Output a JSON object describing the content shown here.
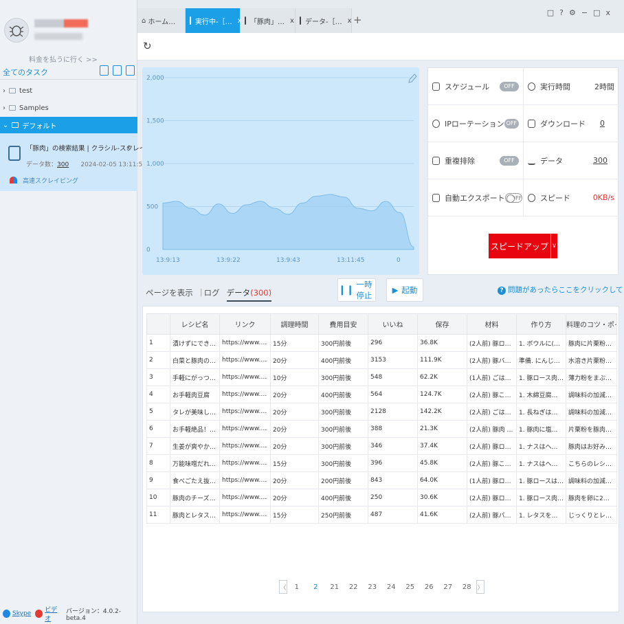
{
  "sidebar": {
    "upgrade_link": "料金を払うに行く >>",
    "all_tasks": "全てのタスク",
    "tree": [
      "test",
      "Samples",
      "デフォルト"
    ],
    "task": {
      "title": "「豚肉」の検索結果 | クラシル-スクレイピ…",
      "close": "x",
      "count_label": "データ数：",
      "count": "300",
      "date": "2024-02-05 13:11:50",
      "mode": "高速スクレイピング"
    },
    "footer": {
      "skype": "Skype",
      "video": "ビデオ",
      "version": "バージョン：4.0.2-beta.4"
    }
  },
  "tabs": [
    {
      "label": "ホーム…"
    },
    {
      "label": "実行中-［…"
    },
    {
      "label": "「豚肉」…"
    },
    {
      "label": "データ-［…"
    }
  ],
  "tab_close": "x",
  "tab_add": "+",
  "window_controls": [
    "□",
    "?",
    "⚙",
    "−",
    "□",
    "x"
  ],
  "chart_data": {
    "type": "area",
    "y_ticks": [
      "2,000",
      "1,500",
      "1,000",
      "500",
      "0"
    ],
    "x_ticks": [
      "13:9:13",
      "13:9:22",
      "13:9:43",
      "13:11:45",
      "0"
    ],
    "ylim": [
      0,
      2000
    ],
    "grid": true,
    "values": [
      540,
      560,
      480,
      400,
      530,
      420,
      520,
      560,
      480,
      410,
      540,
      620,
      640,
      610,
      480,
      450,
      560,
      430,
      30
    ]
  },
  "settings": {
    "rows": [
      {
        "left": {
          "label": "スケジュール",
          "toggle": "OFF"
        },
        "right": {
          "label": "実行時間",
          "value": "2時間"
        }
      },
      {
        "left": {
          "label": "IPローテーション",
          "toggle": "OFF"
        },
        "right": {
          "label": "ダウンロード",
          "value": "0"
        }
      },
      {
        "left": {
          "label": "重複排除",
          "toggle": "OFF"
        },
        "right": {
          "label": "データ",
          "value": "300"
        }
      },
      {
        "left": {
          "label": "自動エクスポート",
          "toggle": "OFF"
        },
        "right": {
          "label": "スピード",
          "value": "0KB/s"
        }
      }
    ],
    "speedup": "スピードアップ",
    "speedup_dropdown": "∨"
  },
  "subtabs": {
    "page": "ページを表示",
    "sep": "|",
    "log": "ログ",
    "data": "データ",
    "data_count": "(300)"
  },
  "buttons": {
    "pause": "一時停止",
    "start": "起動"
  },
  "help_icon": "?",
  "help": "問題があったらここをクリックしてください",
  "table": {
    "headers": [
      "",
      "レシピ名",
      "リンク",
      "調理時間",
      "費用目安",
      "いいね",
      "保存",
      "材料",
      "作り方",
      "料理のコツ・ポイン"
    ],
    "rows": [
      [
        "1",
        "漬けずにできる！豚…",
        "https://www.kurashir…",
        "15分",
        "300円前後",
        "296",
        "36.8K",
        "(2人前) 豚ロース肉…",
        "1. ボウルに(A)を入…",
        "豚肉に片栗粉をつけ…"
      ],
      [
        "2",
        "白菜と豚肉のうま煮",
        "https://www.kurashir…",
        "20分",
        "400円前後",
        "3153",
        "111.9K",
        "(2人前) 豚バラ肉(…",
        "準備. にんじんは皮…",
        "水溶き片栗粉は、片…"
      ],
      [
        "3",
        "手軽にがっつり！豚…",
        "https://www.kurashir…",
        "10分",
        "300円前後",
        "548",
        "62.2K",
        "(1人前) ごはん 300…",
        "1. 豚ロース肉に薄…",
        "薄力粉をまぶすと、…"
      ],
      [
        "4",
        "お手軽肉豆腐",
        "https://www.kurashir…",
        "20分",
        "400円前後",
        "564",
        "124.7K",
        "(2人前) 豚こま切れ…",
        "1. 木綿豆腐は8等分…",
        "調味料の加減は、お…"
      ],
      [
        "5",
        "タレが美味しいジュ…",
        "https://www.kurashir…",
        "20分",
        "300円前後",
        "2128",
        "142.2K",
        "(2人前) ごはん 300…",
        "1. 長ねぎは縦に切…",
        "調味料の加減は、お…"
      ],
      [
        "6",
        "お手軽絶品！豚ロー…",
        "https://www.kurashir…",
        "20分",
        "300円前後",
        "388",
        "21.3K",
        "(2人前) 豚肉 (ロー…",
        "1. 豚肉に塩こしょ…",
        "片栗粉を豚肉にまぶ…"
      ],
      [
        "7",
        "生姜が爽やかな豚肉…",
        "https://www.kurashir…",
        "20分",
        "300円前後",
        "346",
        "37.4K",
        "(2人前) 豚ロース (…",
        "1. ナスはヘタを切…",
        "豚肉はお好みの部位…"
      ],
      [
        "8",
        "万能味噌だれで作る…",
        "https://www.kurashir…",
        "15分",
        "300円前後",
        "396",
        "45.8K",
        "(2人前) 豚こま切れ…",
        "1. ナスはヘタを切…",
        "こちらのレシピは、…"
      ],
      [
        "9",
        "食べごたえ抜群！ト…",
        "https://www.kurashir…",
        "20分",
        "200円前後",
        "843",
        "64.0K",
        "(1人前) 豚ロース (…",
        "1. 豚ロースは5ヶ所…",
        "調味料の加減は、お…"
      ],
      [
        "10",
        "豚肉のチーズ入りピ…",
        "https://www.kurashir…",
        "20分",
        "400円前後",
        "250",
        "30.6K",
        "(2人前) 豚ロース 10…",
        "1. 豚ロース肉にピ…",
        "豚肉を卵に2度くぐ…"
      ],
      [
        "11",
        "豚肉とレタスの蒸油…",
        "https://www.kurashir…",
        "15分",
        "250円前後",
        "487",
        "41.6K",
        "(2人前) 豚バラ肉 (…",
        "1. レタスをざく切…",
        "じっくりとレタスを…"
      ]
    ]
  },
  "pager": {
    "prev": "〈",
    "next": "〉",
    "pages": [
      "1",
      "2",
      "21",
      "22",
      "23",
      "24",
      "25",
      "26",
      "27",
      "28"
    ],
    "current": "2"
  }
}
